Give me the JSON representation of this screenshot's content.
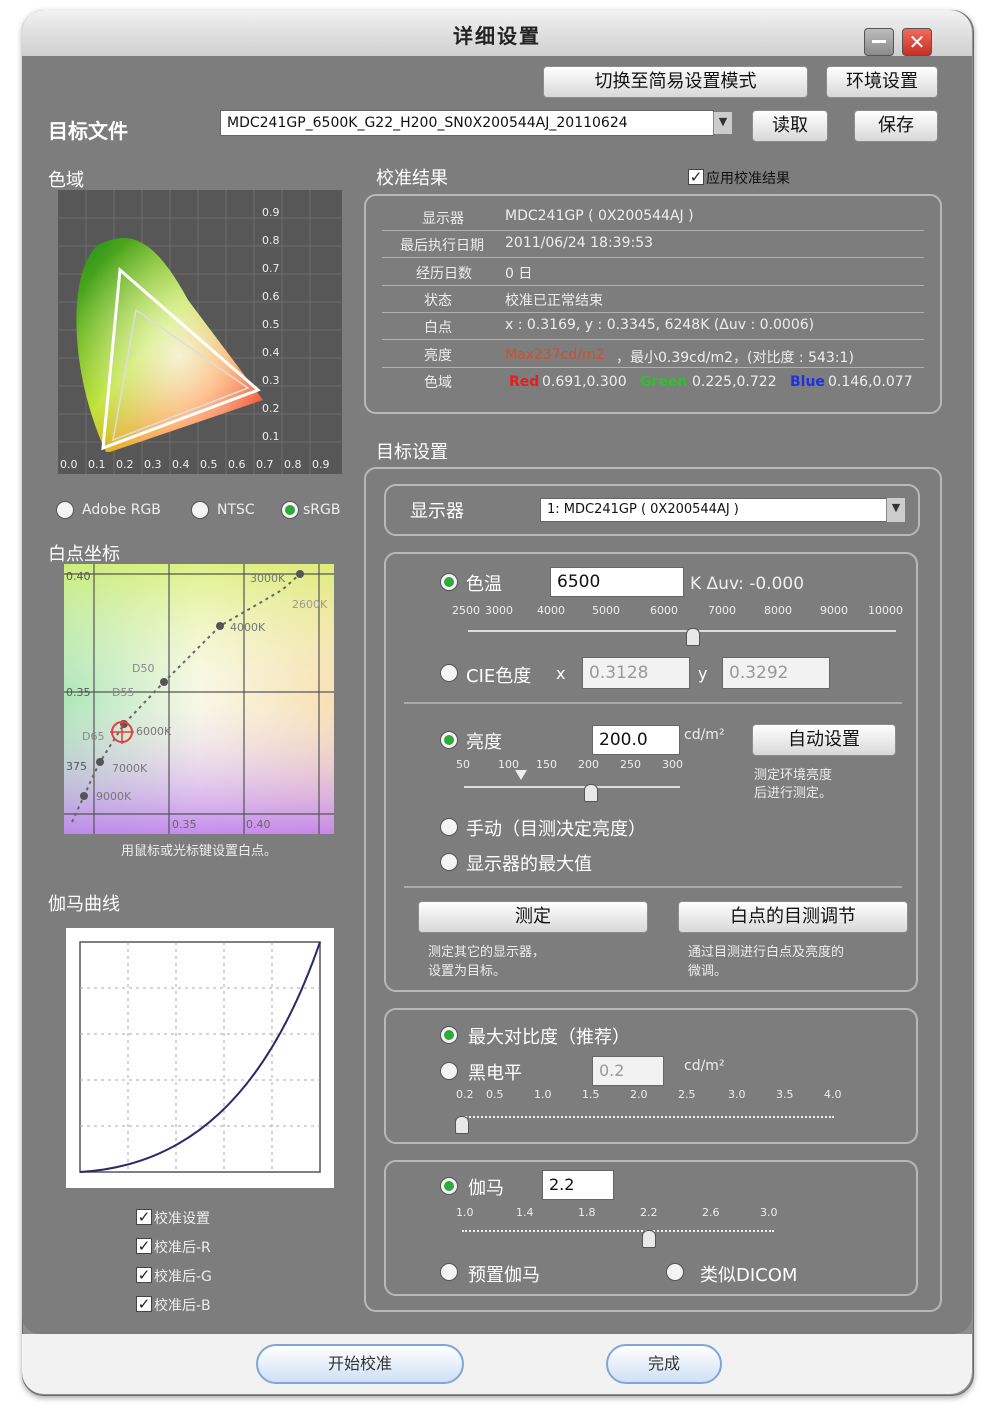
{
  "window": {
    "title": "详细设置"
  },
  "top": {
    "simple_mode_btn": "切换至简易设置模式",
    "env_btn": "环境设置",
    "target_file_label": "目标文件",
    "target_file_value": "MDC241GP_6500K_G22_H200_SN0X200544AJ_20110624",
    "read_btn": "读取",
    "save_btn": "保存"
  },
  "gamut": {
    "title": "色域",
    "xticks": [
      "0.0",
      "0.1",
      "0.2",
      "0.3",
      "0.4",
      "0.5",
      "0.6",
      "0.7",
      "0.8",
      "0.9"
    ],
    "yticks": [
      "0.9",
      "0.8",
      "0.7",
      "0.6",
      "0.5",
      "0.4",
      "0.3",
      "0.2",
      "0.1"
    ],
    "options": [
      "Adobe RGB",
      "NTSC",
      "sRGB"
    ],
    "selected": "sRGB"
  },
  "whitepoint": {
    "title": "白点坐标",
    "labels": [
      "0.40",
      "0.35",
      "375",
      "3000K",
      "2600K",
      "4000K",
      "D50",
      "D55",
      "D65",
      "6000K",
      "7000K",
      "9000K",
      "0.35",
      "0.40"
    ],
    "hint": "用鼠标或光标键设置白点。"
  },
  "gamma_curve": {
    "title": "伽马曲线",
    "checkboxes": [
      "校准设置",
      "校准后-R",
      "校准后-G",
      "校准后-B"
    ]
  },
  "result": {
    "title": "校准结果",
    "apply_label": "应用校准结果",
    "rows": [
      {
        "label": "显示器",
        "value": "MDC241GP ( 0X200544AJ )"
      },
      {
        "label": "最后执行日期",
        "value": "2011/06/24 18:39:53"
      },
      {
        "label": "经历日数",
        "value": "0     日"
      },
      {
        "label": "状态",
        "value": "校准已正常结束"
      },
      {
        "label": "白点",
        "value": "x : 0.3169, y : 0.3345, 6248K (Δuv : 0.0006)"
      },
      {
        "label": "亮度",
        "value_warn": "Max237cd/m2",
        "value": "，最小0.39cd/m2，(对比度 : 543:1)"
      },
      {
        "label": "色域"
      }
    ],
    "gamut_red": "Red",
    "gamut_red_val": "0.691,0.300",
    "gamut_green": "Green",
    "gamut_green_val": "0.225,0.722",
    "gamut_blue": "Blue",
    "gamut_blue_val": "0.146,0.077",
    "colors": {
      "red": "#e02020",
      "green": "#2ec02e",
      "blue": "#2030e0",
      "warn": "#d0502a"
    }
  },
  "target": {
    "title": "目标设置",
    "monitor_label": "显示器",
    "monitor_value": "1: MDC241GP ( 0X200544AJ )",
    "color_temp_label": "色温",
    "color_temp_value": "6500",
    "color_temp_unit": "K  Δuv: -0.000",
    "temp_ticks": [
      "2500",
      "3000",
      "4000",
      "5000",
      "6000",
      "7000",
      "8000",
      "9000",
      "10000"
    ],
    "cie_label": "CIE色度",
    "cie_x_label": "x",
    "cie_x": "0.3128",
    "cie_y_label": "y",
    "cie_y": "0.3292",
    "lum_label": "亮度",
    "lum_value": "200.0",
    "lum_unit": "cd/m²",
    "lum_ticks": [
      "50",
      "100",
      "150",
      "200",
      "250",
      "300"
    ],
    "auto_btn": "自动设置",
    "auto_hint_1": "测定环境亮度",
    "auto_hint_2": "后进行测定。",
    "manual_label": "手动（目测决定亮度）",
    "max_label": "显示器的最大值",
    "measure_btn": "测定",
    "measure_hint_1": "测定其它的显示器，",
    "measure_hint_2": "设置为目标。",
    "visual_btn": "白点的目测调节",
    "visual_hint_1": "通过目测进行白点及亮度的",
    "visual_hint_2": "微调。",
    "contrast_label": "最大对比度（推荐）",
    "black_label": "黑电平",
    "black_value": "0.2",
    "black_unit": "cd/m²",
    "black_ticks": [
      "0.2",
      "0.5",
      "1.0",
      "1.5",
      "2.0",
      "2.5",
      "3.0",
      "3.5",
      "4.0"
    ],
    "gamma_label": "伽马",
    "gamma_value": "2.2",
    "gamma_ticks": [
      "1.0",
      "1.4",
      "1.8",
      "2.2",
      "2.6",
      "3.0"
    ],
    "preset_gamma_label": "预置伽马",
    "dicom_label": "类似DICOM"
  },
  "footer": {
    "start_btn": "开始校准",
    "done_btn": "完成"
  }
}
